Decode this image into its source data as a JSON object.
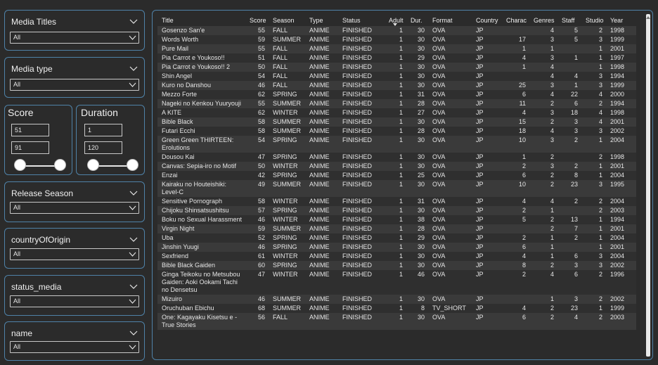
{
  "slicers": [
    {
      "title": "Media Titles",
      "value": "All"
    },
    {
      "title": "Media type",
      "value": "All"
    },
    {
      "title": "Release Season",
      "value": "All"
    },
    {
      "title": "countryOfOrigin",
      "value": "All"
    },
    {
      "title": "status_media",
      "value": "All"
    },
    {
      "title": "name",
      "value": "All"
    }
  ],
  "score_filter": {
    "title": "Score",
    "min": "51",
    "max": "91"
  },
  "duration_filter": {
    "title": "Duration",
    "min": "1",
    "max": "120"
  },
  "table": {
    "columns": [
      "Title",
      "Score",
      "Season",
      "Type",
      "Status",
      "Adult",
      "Dur.",
      "Format",
      "Country",
      "Charac",
      "Genres",
      "Staff",
      "Studio",
      "Year"
    ],
    "sorted_column": "Adult",
    "rows": [
      [
        "Gosenzo San'e",
        "55",
        "FALL",
        "ANIME",
        "FINISHED",
        "1",
        "30",
        "OVA",
        "JP",
        "",
        "4",
        "5",
        "2",
        "1998"
      ],
      [
        "Words Worth",
        "59",
        "SUMMER",
        "ANIME",
        "FINISHED",
        "1",
        "30",
        "OVA",
        "JP",
        "17",
        "3",
        "5",
        "3",
        "1999"
      ],
      [
        "Pure Mail",
        "55",
        "FALL",
        "ANIME",
        "FINISHED",
        "1",
        "30",
        "OVA",
        "JP",
        "1",
        "1",
        "",
        "1",
        "2001"
      ],
      [
        "Pia Carrot e Youkoso!!",
        "51",
        "FALL",
        "ANIME",
        "FINISHED",
        "1",
        "29",
        "OVA",
        "JP",
        "4",
        "3",
        "1",
        "1",
        "1997"
      ],
      [
        "Pia Carrot e Youkoso!! 2",
        "50",
        "FALL",
        "ANIME",
        "FINISHED",
        "1",
        "30",
        "OVA",
        "JP",
        "1",
        "4",
        "",
        "1",
        "1998"
      ],
      [
        "Shin Angel",
        "54",
        "FALL",
        "ANIME",
        "FINISHED",
        "1",
        "30",
        "OVA",
        "JP",
        "",
        "4",
        "4",
        "3",
        "1994"
      ],
      [
        "Kuro no Danshou",
        "46",
        "FALL",
        "ANIME",
        "FINISHED",
        "1",
        "30",
        "OVA",
        "JP",
        "25",
        "3",
        "1",
        "3",
        "1999"
      ],
      [
        "Mezzo Forte",
        "62",
        "SPRING",
        "ANIME",
        "FINISHED",
        "1",
        "31",
        "OVA",
        "JP",
        "6",
        "4",
        "22",
        "4",
        "2000"
      ],
      [
        "Nageki no Kenkou Yuuryouji",
        "55",
        "SUMMER",
        "ANIME",
        "FINISHED",
        "1",
        "28",
        "OVA",
        "JP",
        "11",
        "2",
        "6",
        "2",
        "1994"
      ],
      [
        "A KITE",
        "62",
        "WINTER",
        "ANIME",
        "FINISHED",
        "1",
        "27",
        "OVA",
        "JP",
        "4",
        "3",
        "18",
        "4",
        "1998"
      ],
      [
        "Bible Black",
        "58",
        "SUMMER",
        "ANIME",
        "FINISHED",
        "1",
        "30",
        "OVA",
        "JP",
        "15",
        "2",
        "3",
        "4",
        "2001"
      ],
      [
        "Futari Ecchi",
        "58",
        "SUMMER",
        "ANIME",
        "FINISHED",
        "1",
        "28",
        "OVA",
        "JP",
        "18",
        "4",
        "3",
        "3",
        "2002"
      ],
      [
        "Green Green THIRTEEN: Erolutions",
        "54",
        "SPRING",
        "ANIME",
        "FINISHED",
        "1",
        "30",
        "OVA",
        "JP",
        "10",
        "3",
        "2",
        "1",
        "2004"
      ],
      [
        "Dousou Kai",
        "47",
        "SPRING",
        "ANIME",
        "FINISHED",
        "1",
        "30",
        "OVA",
        "JP",
        "1",
        "2",
        "",
        "2",
        "1998"
      ],
      [
        "Canvas: Sepia-iro no Motif",
        "50",
        "WINTER",
        "ANIME",
        "FINISHED",
        "1",
        "30",
        "OVA",
        "JP",
        "2",
        "3",
        "2",
        "1",
        "2001"
      ],
      [
        "Enzai",
        "42",
        "SPRING",
        "ANIME",
        "FINISHED",
        "1",
        "25",
        "OVA",
        "JP",
        "6",
        "2",
        "8",
        "1",
        "2004"
      ],
      [
        "Kairaku no Houteishiki: Level-C",
        "49",
        "SUMMER",
        "ANIME",
        "FINISHED",
        "1",
        "30",
        "OVA",
        "JP",
        "10",
        "2",
        "23",
        "3",
        "1995"
      ],
      [
        "Sensitive Pornograph",
        "58",
        "WINTER",
        "ANIME",
        "FINISHED",
        "1",
        "31",
        "OVA",
        "JP",
        "4",
        "4",
        "2",
        "2",
        "2004"
      ],
      [
        "Chijoku Shinsatsushitsu",
        "57",
        "SPRING",
        "ANIME",
        "FINISHED",
        "1",
        "30",
        "OVA",
        "JP",
        "2",
        "1",
        "",
        "2",
        "2003"
      ],
      [
        "Boku no Sexual Harassment",
        "46",
        "WINTER",
        "ANIME",
        "FINISHED",
        "1",
        "38",
        "OVA",
        "JP",
        "5",
        "2",
        "13",
        "1",
        "1994"
      ],
      [
        "Virgin Night",
        "59",
        "SUMMER",
        "ANIME",
        "FINISHED",
        "1",
        "28",
        "OVA",
        "JP",
        "",
        "2",
        "7",
        "1",
        "2001"
      ],
      [
        "Uba",
        "52",
        "SPRING",
        "ANIME",
        "FINISHED",
        "1",
        "29",
        "OVA",
        "JP",
        "2",
        "1",
        "2",
        "1",
        "2004"
      ],
      [
        "Jinshin Yuugi",
        "46",
        "SPRING",
        "ANIME",
        "FINISHED",
        "1",
        "30",
        "OVA",
        "JP",
        "6",
        "1",
        "",
        "1",
        "2001"
      ],
      [
        "Sexfriend",
        "61",
        "WINTER",
        "ANIME",
        "FINISHED",
        "1",
        "30",
        "OVA",
        "JP",
        "4",
        "1",
        "6",
        "3",
        "2004"
      ],
      [
        "Bible Black Gaiden",
        "60",
        "SPRING",
        "ANIME",
        "FINISHED",
        "1",
        "30",
        "OVA",
        "JP",
        "8",
        "2",
        "3",
        "3",
        "2002"
      ],
      [
        "Ginga Teikoku no Metsubou Gaiden: Aoki Ookami Tachi no Densetsu",
        "47",
        "WINTER",
        "ANIME",
        "FINISHED",
        "1",
        "46",
        "OVA",
        "JP",
        "2",
        "4",
        "6",
        "2",
        "1996"
      ],
      [
        "Mizuiro",
        "46",
        "SUMMER",
        "ANIME",
        "FINISHED",
        "1",
        "30",
        "OVA",
        "JP",
        "",
        "1",
        "3",
        "2",
        "2002"
      ],
      [
        "Oruchuban Ebichu",
        "68",
        "SUMMER",
        "ANIME",
        "FINISHED",
        "1",
        "8",
        "TV_SHORT",
        "JP",
        "4",
        "2",
        "23",
        "1",
        "1999"
      ],
      [
        "One: Kagayaku Kisetsu e - True Stories",
        "56",
        "FALL",
        "ANIME",
        "FINISHED",
        "1",
        "30",
        "OVA",
        "JP",
        "6",
        "2",
        "4",
        "2",
        "2003"
      ]
    ]
  }
}
